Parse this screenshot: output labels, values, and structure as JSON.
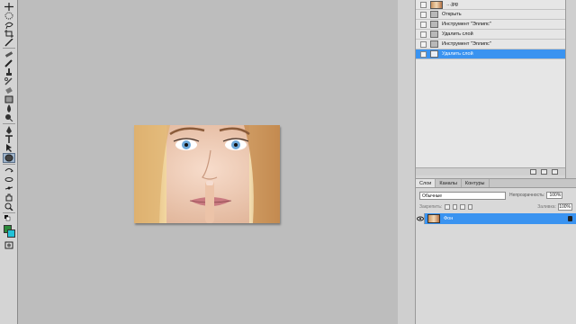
{
  "history": {
    "snapshot_label": "…jpg",
    "items": [
      {
        "label": "Открыть"
      },
      {
        "label": "Инструмент \"Эллипс\""
      },
      {
        "label": "Удалить слой"
      },
      {
        "label": "Инструмент \"Эллипс\""
      },
      {
        "label": "Удалить слой"
      }
    ]
  },
  "layers_panel": {
    "tabs": [
      "Слои",
      "Каналы",
      "Контуры"
    ],
    "blend_mode": "Обычные",
    "opacity_label": "Непрозрачность:",
    "opacity_value": "100%",
    "lock_label": "Закрепить:",
    "fill_label": "Заливка:",
    "fill_value": "100%",
    "layers": [
      {
        "name": "Фон"
      }
    ]
  },
  "colors": {
    "accent": "#3a93f0",
    "foreground": "#2b8a3a",
    "background": "#22c2d8"
  }
}
